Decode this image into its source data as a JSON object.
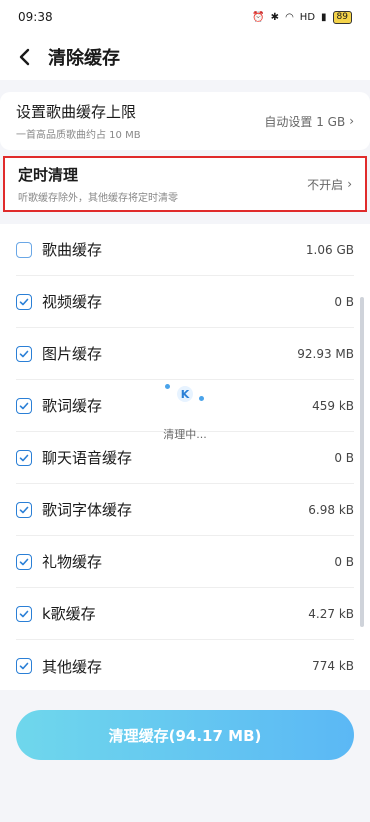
{
  "status": {
    "time": "09:38",
    "battery": "89"
  },
  "header": {
    "title": "清除缓存"
  },
  "limit": {
    "title": "设置歌曲缓存上限",
    "subtitle": "一首高品质歌曲约占 10 MB",
    "value": "自动设置 1 GB"
  },
  "schedule": {
    "title": "定时清理",
    "subtitle": "听歌缓存除外，其他缓存将定时清零",
    "value": "不开启"
  },
  "items": [
    {
      "label": "歌曲缓存",
      "size": "1.06 GB",
      "checked": false
    },
    {
      "label": "视频缓存",
      "size": "0 B",
      "checked": true
    },
    {
      "label": "图片缓存",
      "size": "92.93 MB",
      "checked": true
    },
    {
      "label": "歌词缓存",
      "size": "459 kB",
      "checked": true
    },
    {
      "label": "聊天语音缓存",
      "size": "0 B",
      "checked": true
    },
    {
      "label": "歌词字体缓存",
      "size": "6.98 kB",
      "checked": true
    },
    {
      "label": "礼物缓存",
      "size": "0 B",
      "checked": true
    },
    {
      "label": "k歌缓存",
      "size": "4.27 kB",
      "checked": true
    },
    {
      "label": "其他缓存",
      "size": "774 kB",
      "checked": true
    }
  ],
  "loading": {
    "text": "清理中...",
    "logo": "K"
  },
  "button": {
    "label": "清理缓存(94.17 MB)"
  },
  "colors": {
    "accent": "#2a7fd6",
    "highlight": "#e02b2b",
    "button_from": "#6fd7ec",
    "button_to": "#5bb8f5"
  }
}
